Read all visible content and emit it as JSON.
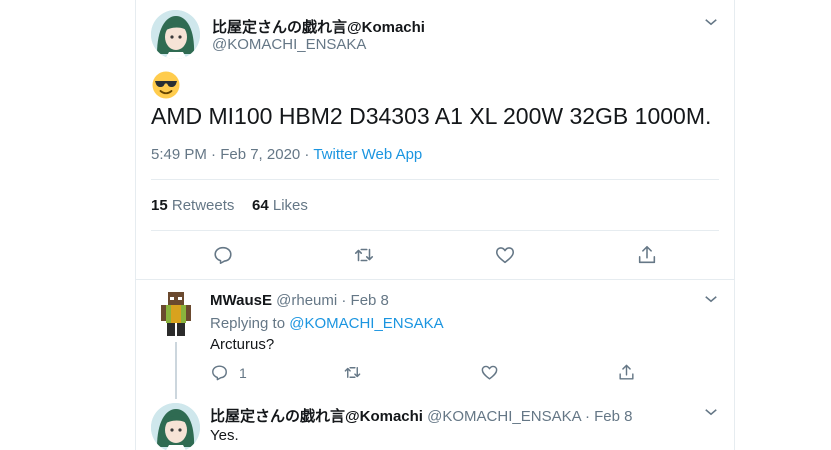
{
  "main_tweet": {
    "display_name": "比屋定さんの戯れ言@Komachi",
    "handle": "@KOMACHI_ENSAKA",
    "emoji": "😎",
    "text": "AMD MI100 HBM2 D34303 A1 XL 200W 32GB 1000M.",
    "time": "5:49 PM · Feb 7, 2020 · ",
    "source": "Twitter Web App",
    "retweets_count": "15",
    "retweets_label": "Retweets",
    "likes_count": "64",
    "likes_label": "Likes"
  },
  "reply1": {
    "display_name": "MWausE",
    "handle": "@rheumi",
    "date": "· Feb 8",
    "replying_prefix": "Replying to ",
    "replying_to": "@KOMACHI_ENSAKA",
    "text": "Arcturus?",
    "reply_count": "1"
  },
  "reply2": {
    "display_name": "比屋定さんの戯れ言@Komachi",
    "handle": "@KOMACHI_ENSAKA",
    "date": "· Feb 8",
    "text": "Yes."
  },
  "colors": {
    "accent": "#1b95e0",
    "text": "#14171a",
    "muted": "#657786",
    "divider": "#e6ecf0"
  }
}
